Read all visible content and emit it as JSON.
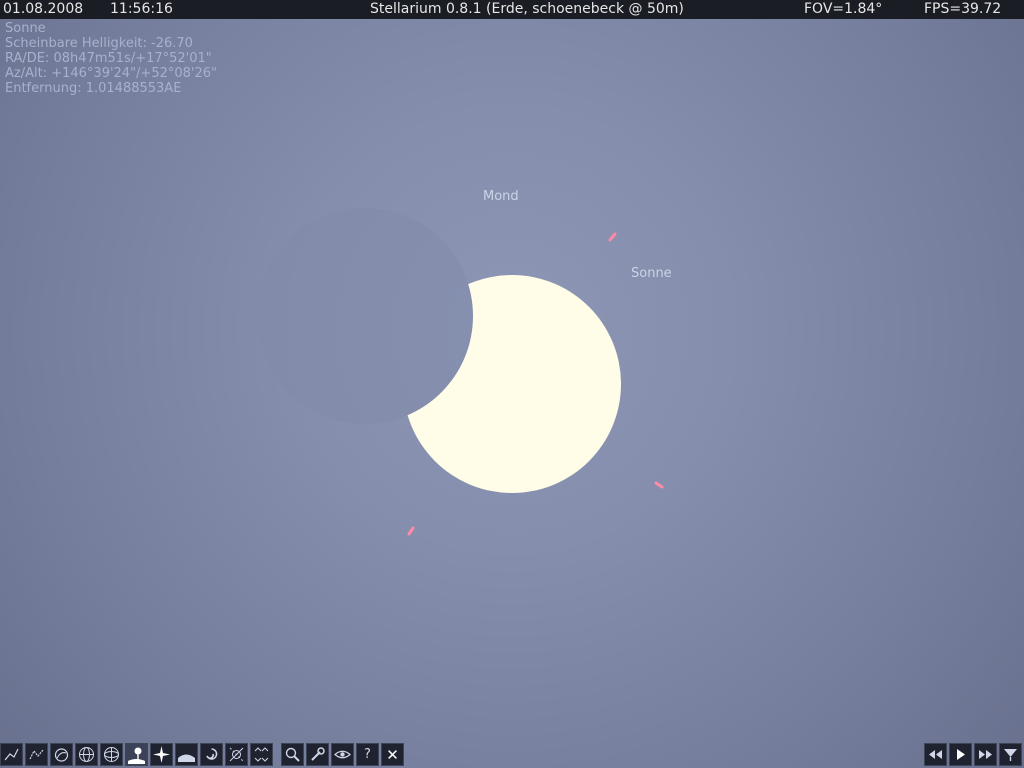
{
  "topbar": {
    "date": "01.08.2008",
    "time": "11:56:16",
    "title": "Stellarium 0.8.1 (Erde, schoenebeck @ 50m)",
    "fov": "FOV=1.84°",
    "fps": "FPS=39.72"
  },
  "selected_object": {
    "name": "Sonne",
    "magnitude": "Scheinbare Helligkeit: -26.70",
    "ra_de": "RA/DE: 08h47m51s/+17°52'01\"",
    "az_alt": "Az/Alt: +146°39'24\"/+52°08'26\"",
    "distance": "Entfernung: 1.01488553AE"
  },
  "sky": {
    "moon_label": "Mond",
    "sun_label": "Sonne",
    "sun_color": "#fffde8",
    "marker_color": "#ff8aa8"
  },
  "toolbar": {
    "left_buttons": [
      {
        "id": "constellation-lines",
        "icon": "constellation-lines-icon"
      },
      {
        "id": "constellation-names",
        "icon": "constellation-names-icon"
      },
      {
        "id": "constellation-art",
        "icon": "constellation-art-icon"
      },
      {
        "id": "azimuth-grid",
        "icon": "azimuth-grid-icon"
      },
      {
        "id": "equatorial-grid",
        "icon": "equatorial-grid-icon"
      },
      {
        "id": "ground",
        "icon": "ground-icon"
      },
      {
        "id": "cardinal-points",
        "icon": "cardinal-points-icon"
      },
      {
        "id": "atmosphere",
        "icon": "atmosphere-icon"
      },
      {
        "id": "nebulae",
        "icon": "nebula-icon"
      },
      {
        "id": "planet-hints",
        "icon": "planet-hints-icon"
      },
      {
        "id": "mount-mode",
        "icon": "mount-icon"
      },
      {
        "id": "search",
        "icon": "search-icon"
      },
      {
        "id": "configuration",
        "icon": "wrench-icon"
      },
      {
        "id": "night-mode",
        "icon": "eye-icon"
      },
      {
        "id": "help",
        "icon": "help-icon",
        "glyph": "?"
      },
      {
        "id": "quit",
        "icon": "close-icon",
        "glyph": "✕"
      }
    ],
    "right_buttons": [
      {
        "id": "rewind",
        "icon": "rewind-icon"
      },
      {
        "id": "play",
        "icon": "play-icon"
      },
      {
        "id": "fast-forward",
        "icon": "fast-forward-icon"
      },
      {
        "id": "realtime",
        "icon": "realtime-icon"
      }
    ]
  }
}
